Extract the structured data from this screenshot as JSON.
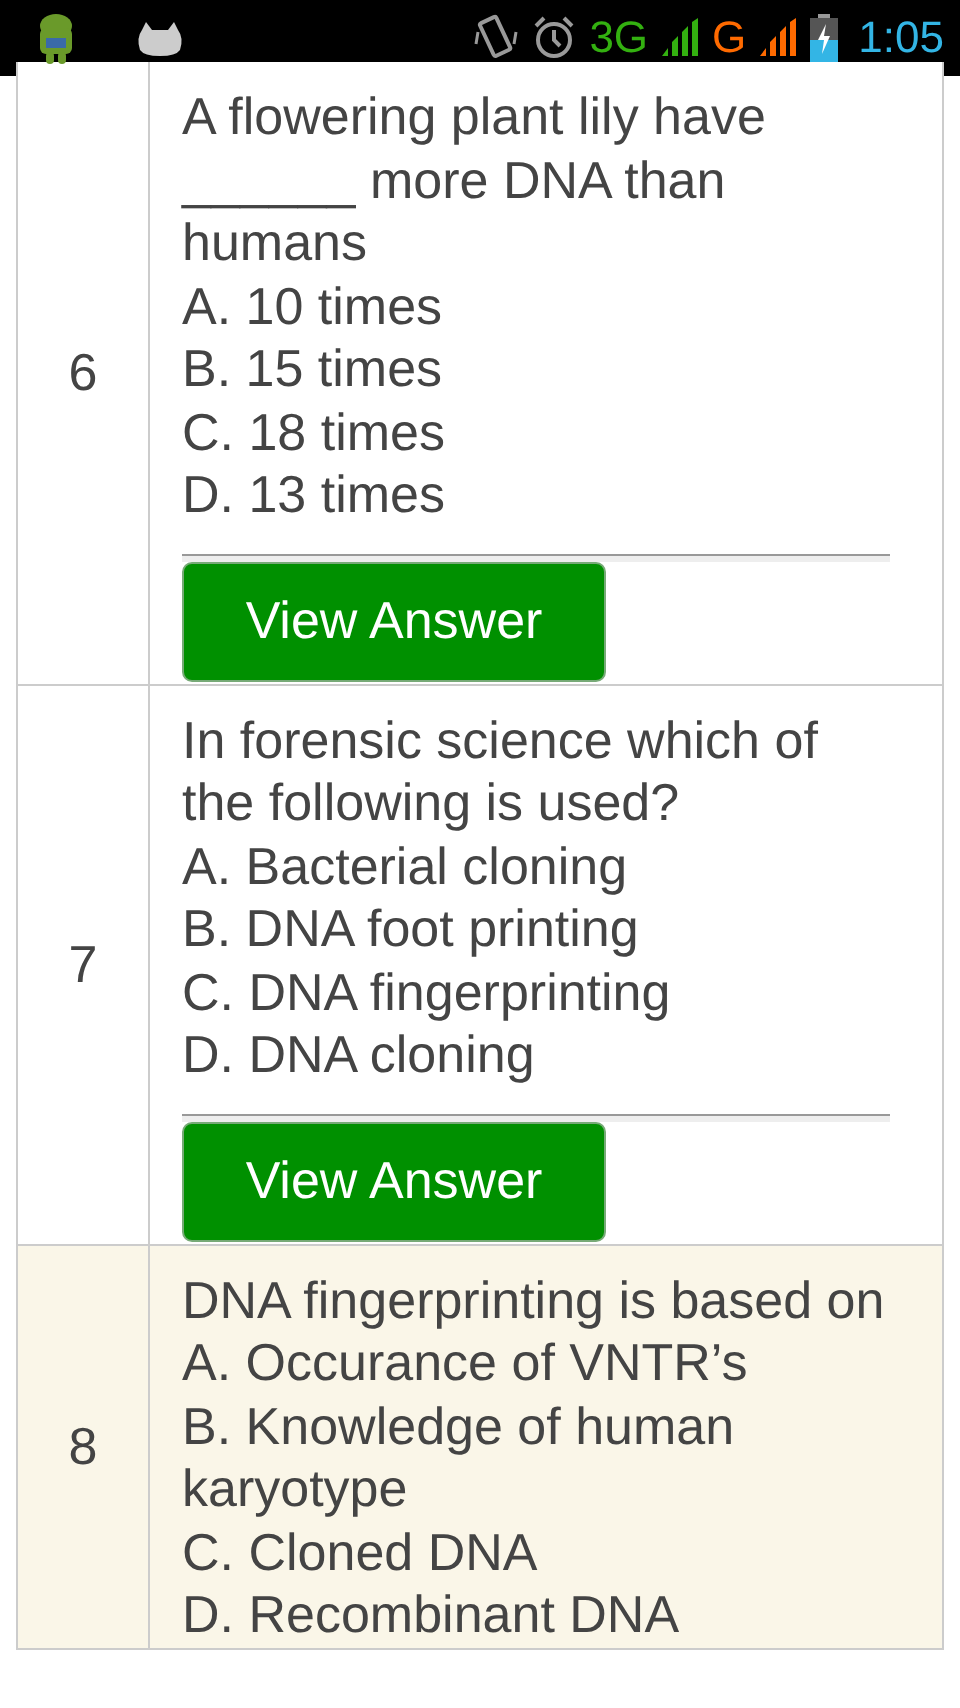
{
  "status_bar": {
    "network_1": "3G",
    "network_2": "G",
    "time": "1:05"
  },
  "questions": [
    {
      "number": "6",
      "question": "A flowering plant lily have ______ more DNA than humans",
      "options": [
        "A. 10 times",
        "B. 15 times",
        "C. 18 times",
        "D. 13 times"
      ],
      "button": "View Answer",
      "highlighted": false
    },
    {
      "number": "7",
      "question": "In forensic science which of the following is used?",
      "options": [
        "A. Bacterial cloning",
        "B. DNA foot printing",
        "C. DNA fingerprinting",
        "D. DNA cloning"
      ],
      "button": "View Answer",
      "highlighted": false
    },
    {
      "number": "8",
      "question": "DNA fingerprinting is based on",
      "options": [
        "A. Occurance of VNTR’s",
        "B. Knowledge of human karyotype",
        "C. Cloned DNA",
        "D. Recombinant DNA"
      ],
      "highlighted": true
    }
  ]
}
